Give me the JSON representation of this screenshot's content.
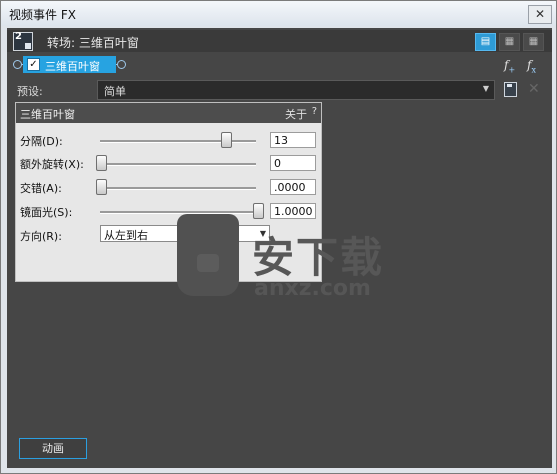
{
  "window": {
    "title": "视频事件 FX",
    "close_glyph": "✕"
  },
  "chain": {
    "icon_number": "2",
    "label": "转场: 三维百叶窗",
    "view_buttons": [
      "▤",
      "▦",
      "▦"
    ]
  },
  "plugin": {
    "checked": true,
    "check_glyph": "✓",
    "name": "三维百叶窗"
  },
  "fx_buttons": {
    "add": "f",
    "add_sub": "+",
    "remove": "f",
    "remove_sub": "x"
  },
  "preset": {
    "label": "预设:",
    "value": "简单",
    "arrow": "▼"
  },
  "panel": {
    "title": "三维百叶窗",
    "about": "关于",
    "help": "?",
    "params": [
      {
        "label": "分隔(D):",
        "value": "13",
        "slider_fraction": 0.9
      },
      {
        "label": "额外旋转(X):",
        "value": "0",
        "slider_fraction": 0.0
      },
      {
        "label": "交错(A):",
        "value": ".0000",
        "slider_fraction": 0.0
      },
      {
        "label": "镜面光(S):",
        "value": "1.0000",
        "slider_fraction": 1.0
      }
    ],
    "direction": {
      "label": "方向(R):",
      "value": "从左到右",
      "arrow": "▼"
    }
  },
  "watermark": {
    "brand": "安下载",
    "domain": "anxz.com"
  },
  "footer": {
    "animate_label": "动画"
  },
  "colors": {
    "accent": "#27a3e1",
    "panel_bg": "#464646",
    "properties_bg": "#e7e7e7"
  }
}
